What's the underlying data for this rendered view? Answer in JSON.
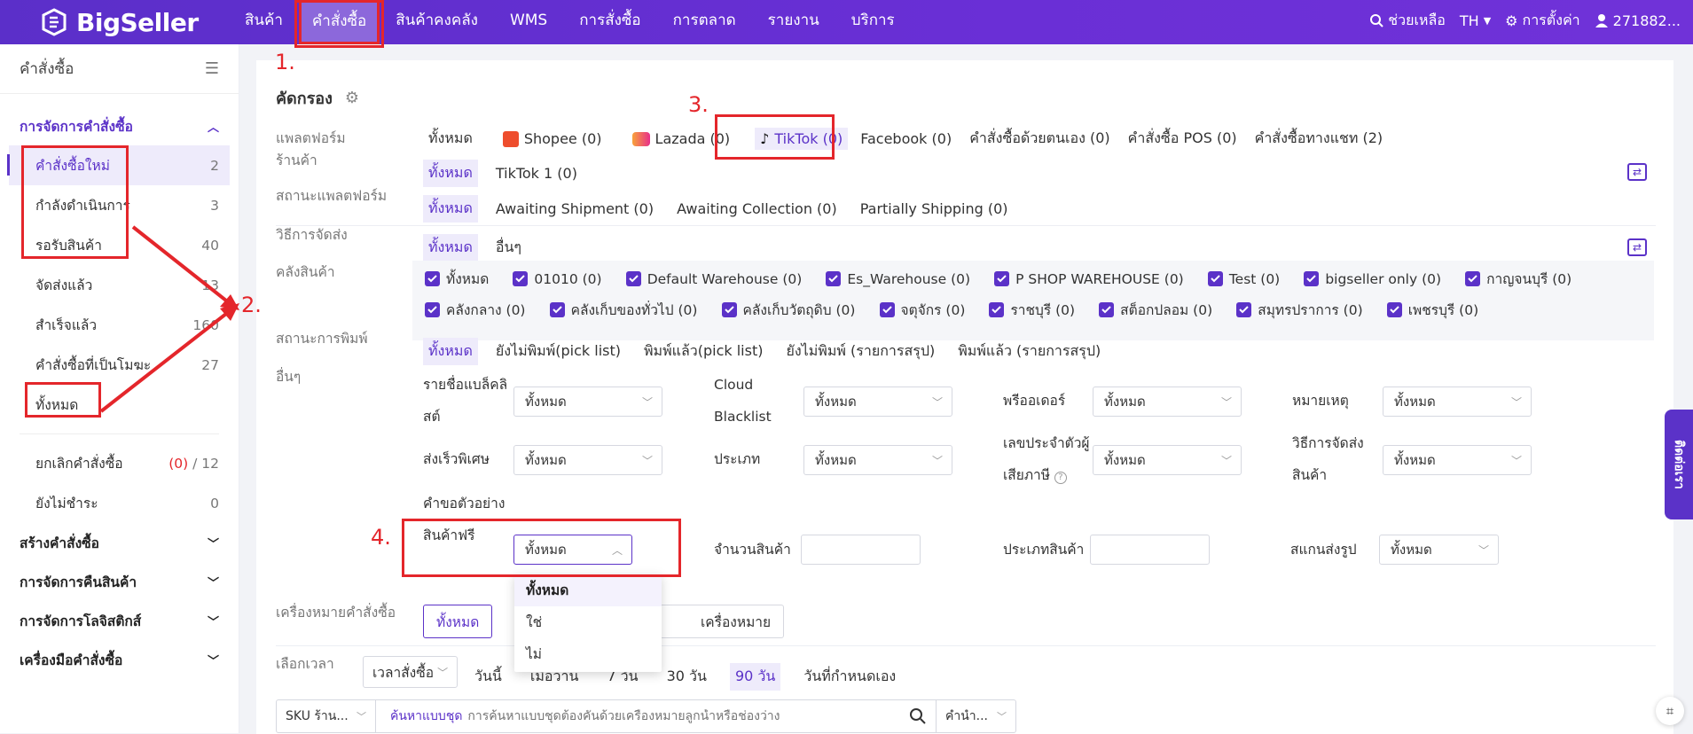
{
  "app": {
    "brand": "BigSeller"
  },
  "nav": [
    "สินค้า",
    "คำสั่งซื้อ",
    "สินค้าคงคลัง",
    "WMS",
    "การสั่งซื้อ",
    "การตลาด",
    "รายงาน",
    "บริการ"
  ],
  "topright": {
    "help": "ช่วยเหลือ",
    "lang": "TH",
    "settings": "การตั้งค่า",
    "user": "271882..."
  },
  "sidebar": {
    "title": "คำสั่งซื้อ",
    "group_manage": "การจัดการคำสั่งซื้อ",
    "items": [
      {
        "label": "คำสั่งซื้อใหม่",
        "count": "2"
      },
      {
        "label": "กำลังดำเนินการ",
        "count": "3"
      },
      {
        "label": "รอรับสินค้า",
        "count": "40"
      },
      {
        "label": "จัดส่งแล้ว",
        "count": "13"
      },
      {
        "label": "สำเร็จแล้ว",
        "count": "160"
      },
      {
        "label": "คำสั่งซื้อที่เป็นโมฆะ",
        "count": "27"
      },
      {
        "label": "ทั้งหมด",
        "count": ""
      }
    ],
    "cancel": {
      "label": "ยกเลิกคำสั่งซื้อ",
      "count_red": "(0)",
      "sep": "/",
      "total": "12"
    },
    "unpaid": {
      "label": "ยังไม่ชำระ",
      "count": "0"
    },
    "groups": [
      "สร้างคำสั่งซื้อ",
      "การจัดการคืนสินค้า",
      "การจัดการโลจิสติกส์",
      "เครื่องมือคำสั่งซื้อ"
    ]
  },
  "filter": {
    "title": "คัดกรอง",
    "platform": {
      "label": "แพลตฟอร์ม",
      "options": [
        "ทั้งหมด",
        "Shopee (0)",
        "Lazada (0)",
        "TikTok (0)",
        "Facebook (0)",
        "คำสั่งซื้อด้วยตนเอง (0)",
        "คำสั่งซื้อ POS (0)",
        "คำสั่งซื้อทางแชท (2)"
      ]
    },
    "store": {
      "label": "ร้านค้า",
      "options": [
        "ทั้งหมด",
        "TikTok 1 (0)"
      ]
    },
    "pstatus": {
      "label": "สถานะแพลตฟอร์ม",
      "options": [
        "ทั้งหมด",
        "Awaiting Shipment (0)",
        "Awaiting Collection (0)",
        "Partially Shipping (0)"
      ]
    },
    "shipping": {
      "label": "วิธีการจัดส่ง",
      "options": [
        "ทั้งหมด",
        "อื่นๆ"
      ]
    },
    "warehouse": {
      "label": "คลังสินค้า",
      "row1": [
        "ทั้งหมด",
        "01010 (0)",
        "Default Warehouse (0)",
        "Es_Warehouse (0)",
        "P SHOP WAREHOUSE (0)",
        "Test (0)",
        "bigseller only (0)",
        "กาญจนบุรี (0)"
      ],
      "row2": [
        "คลังกลาง (0)",
        "คลังเก็บของทั่วไป (0)",
        "คลังเก็บวัตถุดิบ (0)",
        "จตุจักร (0)",
        "ราชบุรี (0)",
        "สต็อกปลอม (0)",
        "สมุทรปราการ (0)",
        "เพชรบุรี (0)"
      ]
    },
    "print": {
      "label": "สถานะการพิมพ์",
      "options": [
        "ทั้งหมด",
        "ยังไม่พิมพ์(pick list)",
        "พิมพ์แล้ว(pick list)",
        "ยังไม่พิมพ์ (รายการสรุป)",
        "พิมพ์แล้ว (รายการสรุป)"
      ]
    },
    "other": {
      "label": "อื่นๆ",
      "blacklist": {
        "l1": "รายชื่อแบล็คลิ",
        "l2": "สต์"
      },
      "cloud": {
        "l1": "Cloud",
        "l2": "Blacklist"
      },
      "preorder": "พรีออเดอร์",
      "note": "หมายเหตุ",
      "express": "ส่งเร็วพิเศษ",
      "type": "ประเภท",
      "taxid": {
        "l1": "เลขประจำตัวผู้",
        "l2": "เสียภาษี"
      },
      "shipmethod": {
        "l1": "วิธีการจัดส่ง",
        "l2": "สินค้า"
      },
      "sample": {
        "l1": "คำขอตัวอย่าง",
        "l2": "สินค้าฟรี"
      },
      "qty": "จำนวนสินค้า",
      "ptype": "ประเภทสินค้า",
      "scan": "สแกนส่งรูป",
      "all": "ทั้งหมด"
    },
    "ordermark": {
      "label": "เครื่องหมายคำสั่งซื้อ",
      "all": "ทั้งหมด",
      "mark": "เครื่องหมาย"
    },
    "time": {
      "label": "เลือกเวลา",
      "select": "เวลาสั่งซื้อ",
      "options": [
        "วันนี้",
        "เมื่อวาน",
        "7 วัน",
        "30 วัน",
        "90 วัน",
        "วันที่กำหนดเอง"
      ]
    },
    "search": {
      "sku": "SKU ร้าน...",
      "batch": "ค้นหาแบบชุด",
      "placeholder": "การค้นหาแบบชุดต้องคั่นด้วยเครื่องหมายลูกน้ำหรือช่องว่าง",
      "right": "คำนำ..."
    }
  },
  "dropdown": [
    "ทั้งหมด",
    "ใช่",
    "ไม่"
  ],
  "annotations": {
    "n1": "1.",
    "n2": "2.",
    "n3": "3.",
    "n4": "4."
  },
  "float": {
    "label": "ติดต่อเรา"
  },
  "colors": {
    "primary": "#5b32c8",
    "annotation": "#e4262b"
  }
}
